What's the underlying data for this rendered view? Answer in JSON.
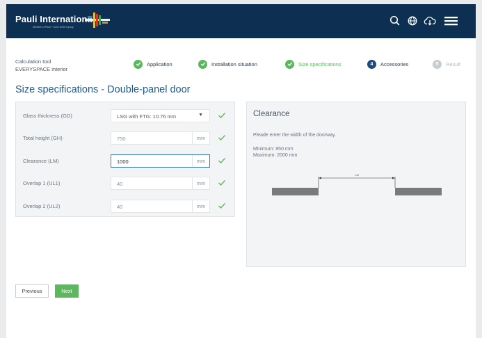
{
  "header": {
    "logo_text": "Pauli International",
    "logo_subtext": "Member of Pauli + Sohn GmbH group"
  },
  "calc": {
    "line1": "Calculation tool",
    "line2": "EVERYSPACE interior"
  },
  "steps": [
    {
      "label": "Application",
      "state": "done"
    },
    {
      "label": "Installation situation",
      "state": "done"
    },
    {
      "label": "Size specifications",
      "state": "done"
    },
    {
      "label": "Accessories",
      "number": "4",
      "state": "current"
    },
    {
      "label": "Result",
      "number": "5",
      "state": "todo"
    }
  ],
  "page_title": "Size specifications - Double-panel door",
  "form": {
    "rows": [
      {
        "label": "Glass thickness (GD)",
        "value": "LSG with FTG: 10.76 mm",
        "type": "select"
      },
      {
        "label": "Total height (GH)",
        "value": "750",
        "unit": "mm"
      },
      {
        "label": "Clearance (LM)",
        "value": "1000",
        "unit": "mm",
        "active": true
      },
      {
        "label": "Overlap 1 (UL1)",
        "value": "40",
        "unit": "mm"
      },
      {
        "label": "Overlap 2 (UL2)",
        "value": "40",
        "unit": "mm"
      }
    ]
  },
  "info": {
    "title": "Clearance",
    "description": "Pleade enter the width of the doorway.",
    "minimum": "Minimum: 950 mm",
    "maximum": "Maximum: 2000 mm",
    "diagram_label": "LM"
  },
  "buttons": {
    "previous": "Previous",
    "next": "Next"
  },
  "colors": {
    "header_bg": "#0d2f52",
    "accent_green": "#5bb85d",
    "title_blue": "#1f5a8c",
    "current_step": "#1f4a7a"
  }
}
